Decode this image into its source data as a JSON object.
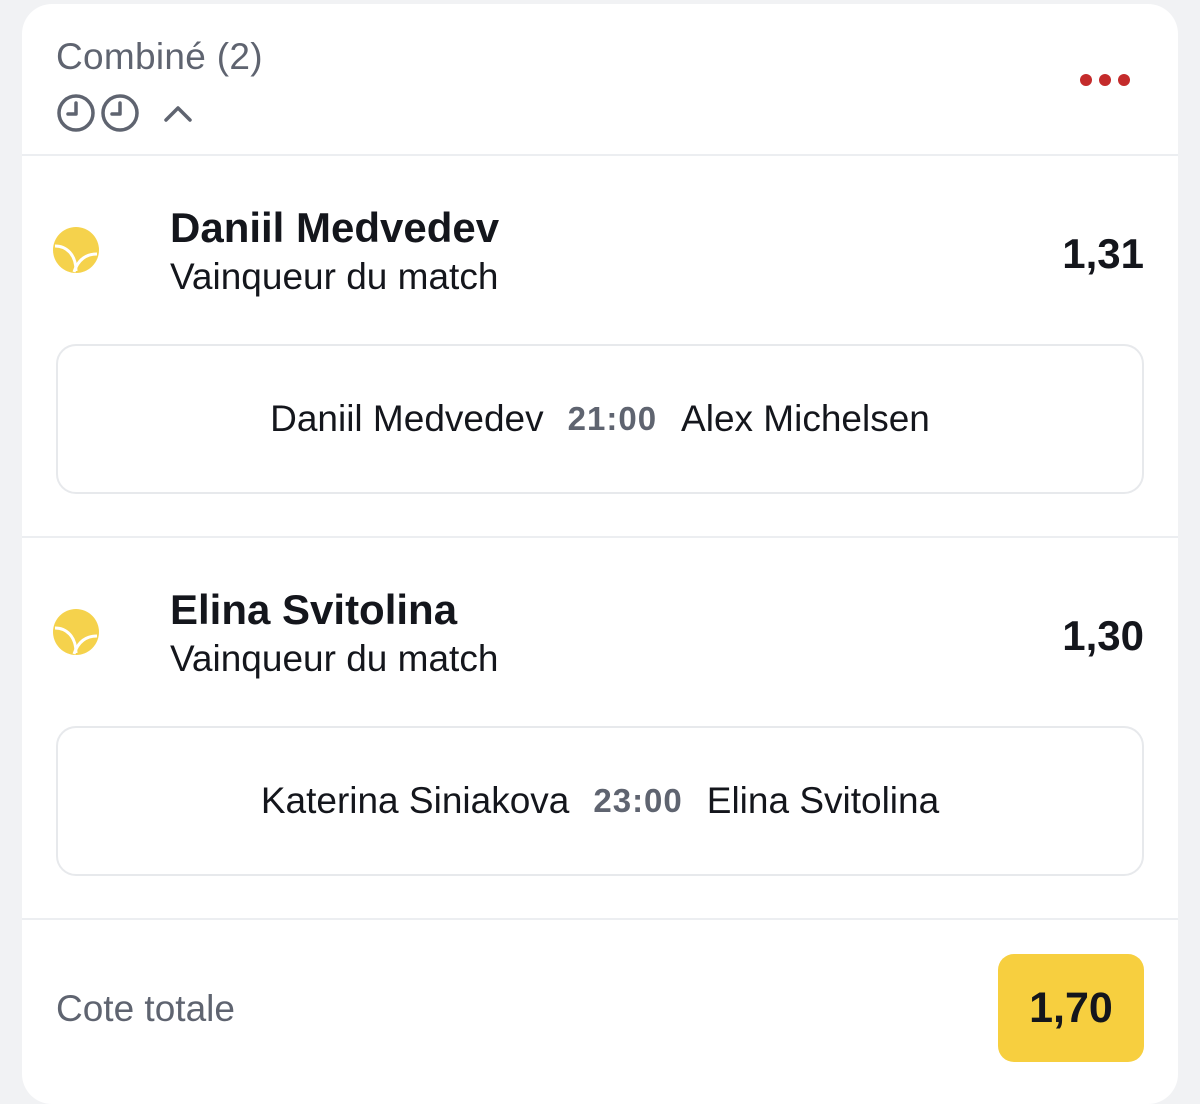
{
  "header": {
    "title": "Combiné (2)",
    "icons": [
      "clock-icon",
      "clock-icon",
      "chevron-up-icon"
    ],
    "menu_icon": "more-horizontal-icon"
  },
  "selections": [
    {
      "sport_icon": "tennis-ball-icon",
      "name": "Daniil Medvedev",
      "market": "Vainqueur du match",
      "odds": "1,31",
      "match": {
        "home": "Daniil Medvedev",
        "time": "21:00",
        "away": "Alex Michelsen"
      }
    },
    {
      "sport_icon": "tennis-ball-icon",
      "name": "Elina Svitolina",
      "market": "Vainqueur du match",
      "odds": "1,30",
      "match": {
        "home": "Katerina Siniakova",
        "time": "23:00",
        "away": "Elina Svitolina"
      }
    }
  ],
  "footer": {
    "total_label": "Cote totale",
    "total_odds": "1,70"
  },
  "colors": {
    "accent_red": "#c42b2b",
    "badge_yellow": "#f7cf3f",
    "ball_yellow": "#f5d24c",
    "text_primary": "#14161c",
    "text_secondary": "#5f6470"
  }
}
